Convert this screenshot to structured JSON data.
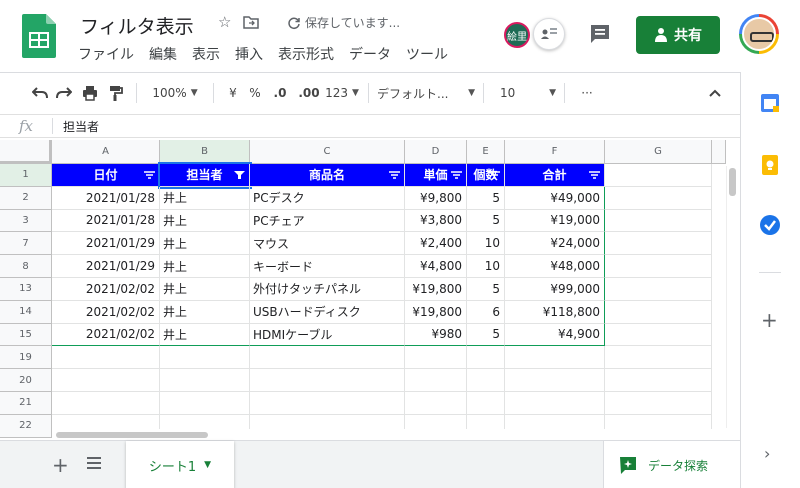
{
  "app": {
    "title": "フィルタ表示",
    "save_status": "保存しています...",
    "menu": [
      "ファイル",
      "編集",
      "表示",
      "挿入",
      "表示形式",
      "データ",
      "ツール"
    ],
    "share_label": "共有",
    "avatar_label": "絵里"
  },
  "toolbar": {
    "zoom": "100%",
    "currency": "¥",
    "percent": "%",
    "decimal_decrease": ".0",
    "decimal_increase": ".00",
    "number_format": "123",
    "font": "デフォルト...",
    "font_size": "10",
    "more": "···"
  },
  "formula_bar": {
    "fx": "fx",
    "value": "担当者"
  },
  "sheet": {
    "columns": [
      "A",
      "B",
      "C",
      "D",
      "E",
      "F",
      "G"
    ],
    "row_numbers": [
      "1",
      "2",
      "3",
      "7",
      "8",
      "13",
      "14",
      "15",
      "19",
      "20",
      "21",
      "22"
    ],
    "headers": [
      "日付",
      "担当者",
      "商品名",
      "単価",
      "個数",
      "合計"
    ],
    "rows": [
      [
        "2021/01/28",
        "井上",
        "PCデスク",
        "¥9,800",
        "5",
        "¥49,000"
      ],
      [
        "2021/01/28",
        "井上",
        "PCチェア",
        "¥3,800",
        "5",
        "¥19,000"
      ],
      [
        "2021/01/29",
        "井上",
        "マウス",
        "¥2,400",
        "10",
        "¥24,000"
      ],
      [
        "2021/01/29",
        "井上",
        "キーボード",
        "¥4,800",
        "10",
        "¥48,000"
      ],
      [
        "2021/02/02",
        "井上",
        "外付けタッチパネル",
        "¥19,800",
        "5",
        "¥99,000"
      ],
      [
        "2021/02/02",
        "井上",
        "USBハードディスク",
        "¥19,800",
        "6",
        "¥118,800"
      ],
      [
        "2021/02/02",
        "井上",
        "HDMIケーブル",
        "¥980",
        "5",
        "¥4,900"
      ]
    ]
  },
  "bottom": {
    "add_sheet": "+",
    "sheet_tab": "シート1",
    "explore": "データ探索"
  },
  "icons": {
    "undo": "undo-icon",
    "redo": "redo-icon",
    "print": "print-icon",
    "paint_format": "paint-format-icon",
    "star": "star-icon",
    "move": "folder-icon",
    "sync": "sync-icon",
    "comment": "comment-icon",
    "filter": "filter-icon",
    "calendar": "calendar-icon",
    "keep": "keep-icon",
    "tasks": "tasks-icon"
  },
  "colors": {
    "header_fill": "#0000ff",
    "accent_green": "#188038",
    "selected_header": "#e2f0e6"
  }
}
